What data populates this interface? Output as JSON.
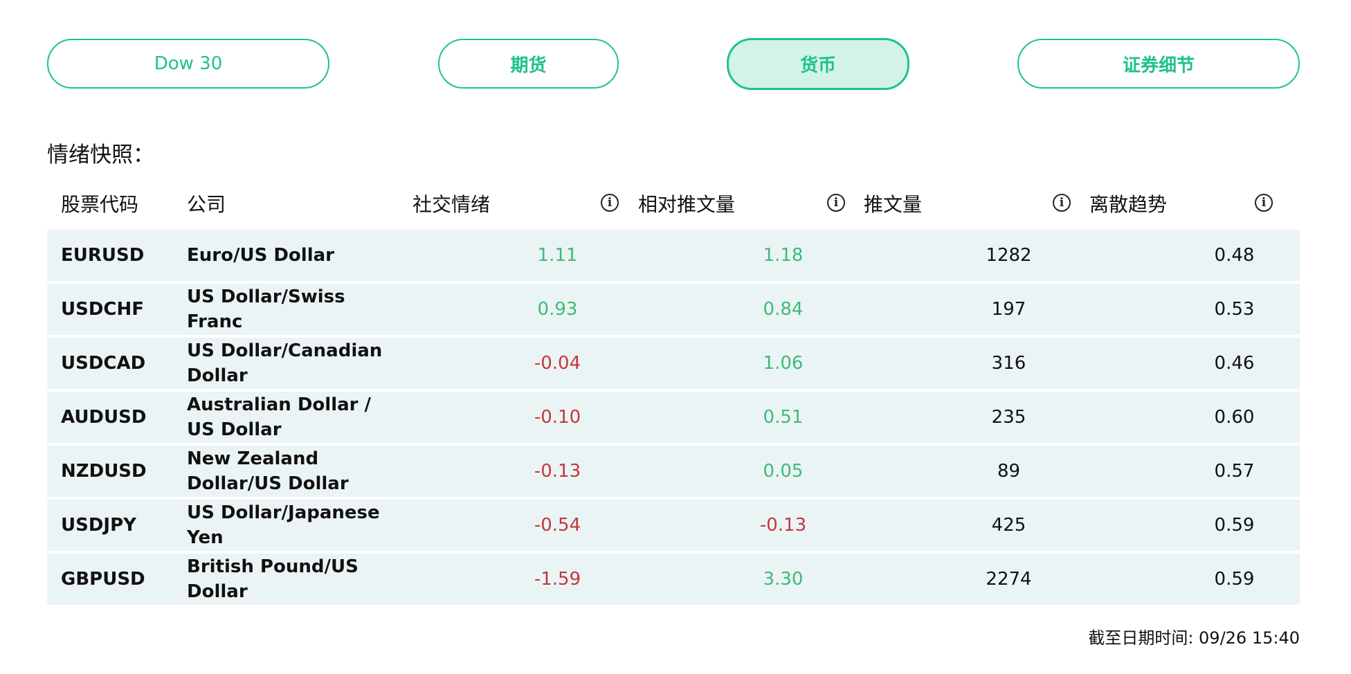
{
  "tabs": [
    {
      "label": "Dow 30",
      "active": false
    },
    {
      "label": "期货",
      "active": false
    },
    {
      "label": "货币",
      "active": true
    },
    {
      "label": "证券细节",
      "active": false
    }
  ],
  "section_title": "情绪快照：",
  "table": {
    "headers": {
      "symbol": "股票代码",
      "company": "公司",
      "sentiment": "社交情绪",
      "relative_volume": "相对推文量",
      "tweet_volume": "推文量",
      "dispersion": "离散趋势"
    },
    "info_icon_glyph": "i",
    "rows": [
      {
        "symbol": "EURUSD",
        "company": "Euro/US Dollar",
        "sentiment": "1.11",
        "relative_volume": "1.18",
        "tweet_volume": "1282",
        "dispersion": "0.48"
      },
      {
        "symbol": "USDCHF",
        "company": "US Dollar/Swiss Franc",
        "sentiment": "0.93",
        "relative_volume": "0.84",
        "tweet_volume": "197",
        "dispersion": "0.53"
      },
      {
        "symbol": "USDCAD",
        "company": "US Dollar/Canadian Dollar",
        "sentiment": "-0.04",
        "relative_volume": "1.06",
        "tweet_volume": "316",
        "dispersion": "0.46"
      },
      {
        "symbol": "AUDUSD",
        "company": "Australian Dollar / US Dollar",
        "sentiment": "-0.10",
        "relative_volume": "0.51",
        "tweet_volume": "235",
        "dispersion": "0.60"
      },
      {
        "symbol": "NZDUSD",
        "company": "New Zealand Dollar/US Dollar",
        "sentiment": "-0.13",
        "relative_volume": "0.05",
        "tweet_volume": "89",
        "dispersion": "0.57"
      },
      {
        "symbol": "USDJPY",
        "company": "US Dollar/Japanese Yen",
        "sentiment": "-0.54",
        "relative_volume": "-0.13",
        "tweet_volume": "425",
        "dispersion": "0.59"
      },
      {
        "symbol": "GBPUSD",
        "company": "British Pound/US Dollar",
        "sentiment": "-1.59",
        "relative_volume": "3.30",
        "tweet_volume": "2274",
        "dispersion": "0.59"
      }
    ]
  },
  "timestamp": "截至日期时间: 09/26 15:40",
  "colors": {
    "accent": "#1ec28b",
    "active_tab_bg": "#d3f3e7",
    "positive": "#3dbb78",
    "negative": "#c4373d",
    "row_bg": "#ebf4f4"
  }
}
